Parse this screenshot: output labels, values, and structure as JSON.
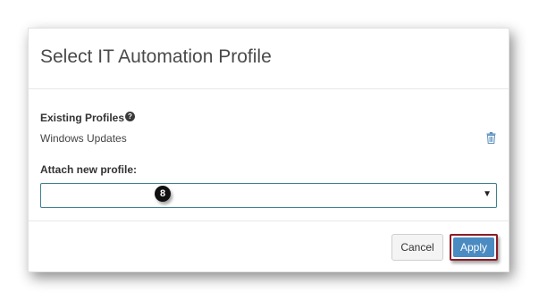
{
  "modal": {
    "title": "Select IT Automation Profile"
  },
  "existing_profiles": {
    "label": "Existing Profiles",
    "help_icon": "question-circle-icon",
    "items": [
      {
        "name": "Windows Updates",
        "delete_icon": "trash-icon"
      }
    ]
  },
  "attach_profile": {
    "label": "Attach new profile:",
    "selected_value": "",
    "dropdown_icon": "caret-down-icon",
    "dropdown_glyph": "▼"
  },
  "annotation": {
    "step_number": "8"
  },
  "footer": {
    "cancel_label": "Cancel",
    "apply_label": "Apply"
  },
  "colors": {
    "apply_button": "#4a8bc2",
    "highlight_outline": "#8c1c26",
    "select_border": "#3f7f8f"
  }
}
